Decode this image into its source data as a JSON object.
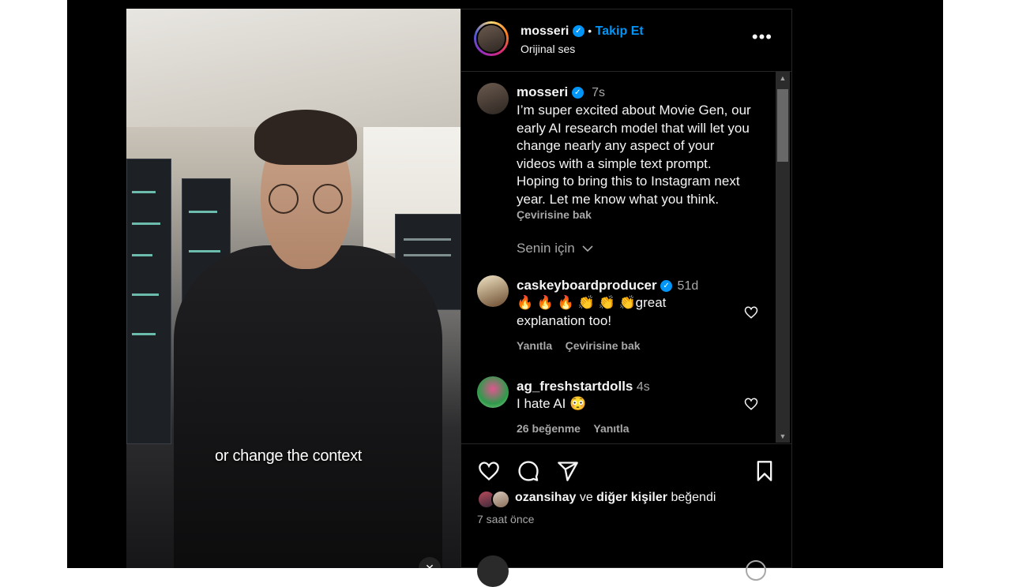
{
  "header": {
    "username": "mosseri",
    "dot": "•",
    "follow_label": "Takip Et",
    "audio_label": "Orijinal ses",
    "more_icon": "more-horizontal-icon"
  },
  "video": {
    "subtitle": "or change the context",
    "mute_icon": "muted-speaker-icon"
  },
  "post": {
    "username": "mosseri",
    "time": "7s",
    "text_lines": [
      "I’m super excited about Movie Gen, our",
      "early AI research model that will let you",
      "change nearly any aspect of your",
      "videos with a simple text prompt.",
      "Hoping to bring this to Instagram next",
      "year. Let me know what you think."
    ],
    "translate_label": "Çevirisine bak"
  },
  "filter": {
    "label": "Senin için",
    "icon": "chevron-down-icon"
  },
  "comments": [
    {
      "username": "caskeyboardproducer",
      "time": "51d",
      "emoji": "🔥 🔥 🔥 👏 👏 👏",
      "text_line1": "great",
      "text_line2": "explanation too!",
      "reply_label": "Yanıtla",
      "translate_label": "Çevirisine bak"
    },
    {
      "username": "ag_freshstartdolls",
      "time": "4s",
      "text": "I hate AI 😳",
      "likes_label": "26 beğenme",
      "reply_label": "Yanıtla"
    }
  ],
  "likes": {
    "user": "ozansihay",
    "connector": "ve",
    "others": "diğer kişiler",
    "suffix": "beğendi"
  },
  "timestamp": "7 saat önce",
  "colors": {
    "accent": "#0095f6",
    "text": "#f5f5f5",
    "muted": "#a8a8a8",
    "background": "#000000",
    "border": "#262626"
  }
}
